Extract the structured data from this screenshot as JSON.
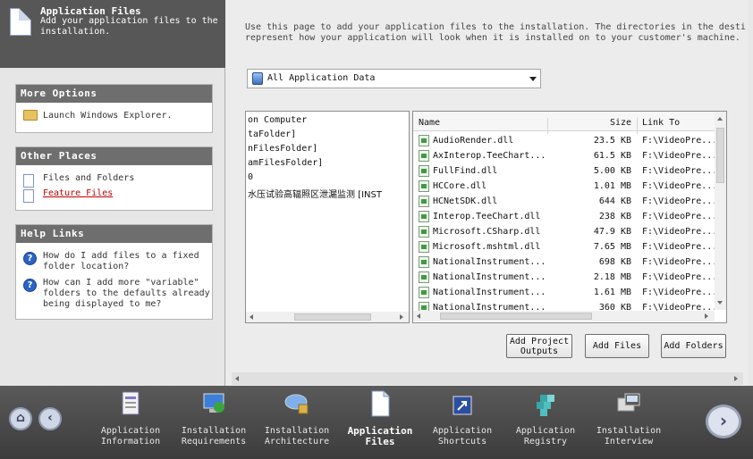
{
  "header": {
    "title": "Application Files",
    "description": "Add your application files to the installation."
  },
  "sidebar": {
    "more_options": {
      "title": "More Options",
      "items": [
        {
          "label": "Launch Windows Explorer.",
          "icon": "folder-icon"
        }
      ]
    },
    "other_places": {
      "title": "Other Places",
      "items": [
        {
          "label": "Files and Folders",
          "icon": "page-icon"
        },
        {
          "label": "Feature Files",
          "icon": "page-icon"
        }
      ]
    },
    "help_links": {
      "title": "Help Links",
      "items": [
        {
          "label": "How do I add files to a fixed folder location?",
          "icon": "help-icon"
        },
        {
          "label": "How can I add more \"variable\" folders to the defaults already being displayed to me?",
          "icon": "help-icon"
        }
      ]
    }
  },
  "intro": {
    "line1": "Use this page to add your application files to the installation. The directories in the destin",
    "line2": "represent how your application will look when it is installed on to your customer's machine."
  },
  "feature_select": {
    "value": "All Application Data"
  },
  "tree": {
    "rows": [
      "on Computer",
      "taFolder]",
      "nFilesFolder]",
      "amFilesFolder]",
      "0",
      "水压试验高辐照区泄漏监测 [INST"
    ]
  },
  "files": {
    "columns": {
      "name": "Name",
      "size": "Size",
      "link": "Link To"
    },
    "rows": [
      {
        "name": "AudioRender.dll",
        "size": "23.5 KB",
        "link": "F:\\VideoPre..."
      },
      {
        "name": "AxInterop.TeeChart...",
        "size": "61.5 KB",
        "link": "F:\\VideoPre..."
      },
      {
        "name": "FullFind.dll",
        "size": "5.00 KB",
        "link": "F:\\VideoPre..."
      },
      {
        "name": "HCCore.dll",
        "size": "1.01 MB",
        "link": "F:\\VideoPre..."
      },
      {
        "name": "HCNetSDK.dll",
        "size": "644 KB",
        "link": "F:\\VideoPre..."
      },
      {
        "name": "Interop.TeeChart.dll",
        "size": "238 KB",
        "link": "F:\\VideoPre..."
      },
      {
        "name": "Microsoft.CSharp.dll",
        "size": "47.9 KB",
        "link": "F:\\VideoPre..."
      },
      {
        "name": "Microsoft.mshtml.dll",
        "size": "7.65 MB",
        "link": "F:\\VideoPre..."
      },
      {
        "name": "NationalInstrument...",
        "size": "698 KB",
        "link": "F:\\VideoPre..."
      },
      {
        "name": "NationalInstrument...",
        "size": "2.18 MB",
        "link": "F:\\VideoPre..."
      },
      {
        "name": "NationalInstrument...",
        "size": "1.61 MB",
        "link": "F:\\VideoPre..."
      },
      {
        "name": "NationalInstrument...",
        "size": "360 KB",
        "link": "F:\\VideoPre..."
      }
    ]
  },
  "buttons": {
    "add_project_outputs_line1": "Add Project",
    "add_project_outputs_line2": "Outputs",
    "add_files": "Add Files",
    "add_folders": "Add Folders"
  },
  "nav": {
    "steps": [
      {
        "line1": "Application",
        "line2": "Information",
        "icon": "info-icon"
      },
      {
        "line1": "Installation",
        "line2": "Requirements",
        "icon": "computer-icon"
      },
      {
        "line1": "Installation",
        "line2": "Architecture",
        "icon": "architecture-icon"
      },
      {
        "line1": "Application",
        "line2": "Files",
        "icon": "files-icon",
        "active": true
      },
      {
        "line1": "Application",
        "line2": "Shortcuts",
        "icon": "shortcut-icon"
      },
      {
        "line1": "Application",
        "line2": "Registry",
        "icon": "registry-icon"
      },
      {
        "line1": "Installation",
        "line2": "Interview",
        "icon": "interview-icon"
      }
    ]
  }
}
